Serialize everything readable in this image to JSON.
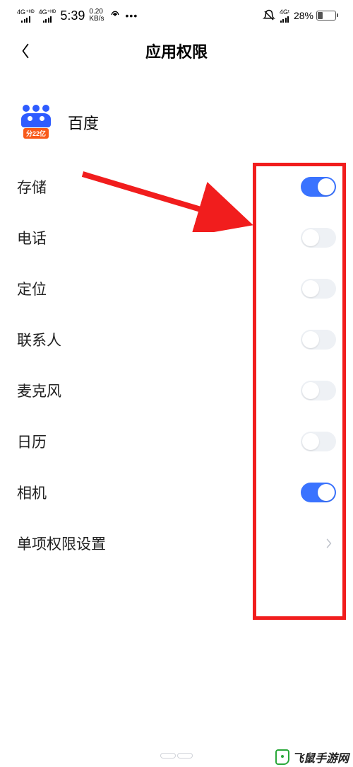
{
  "status_bar": {
    "signal1_label": "4G⁺ᴴᴰ",
    "signal2_label": "4G⁺ᴴᴰ",
    "time": "5:39",
    "data_rate_top": "0.20",
    "data_rate_bottom": "KB/s",
    "hotspot_icon": "wifi-hotspot-icon",
    "more_icon_text": "•••",
    "bell_icon": "bell-off-icon",
    "right_signal_label": "4Gᵗ",
    "battery_percent": "28%"
  },
  "nav": {
    "title": "应用权限"
  },
  "app": {
    "name": "百度",
    "badge": "分22亿"
  },
  "permissions": [
    {
      "label": "存储",
      "enabled": true,
      "type": "toggle"
    },
    {
      "label": "电话",
      "enabled": false,
      "type": "toggle"
    },
    {
      "label": "定位",
      "enabled": false,
      "type": "toggle"
    },
    {
      "label": "联系人",
      "enabled": false,
      "type": "toggle"
    },
    {
      "label": "麦克风",
      "enabled": false,
      "type": "toggle"
    },
    {
      "label": "日历",
      "enabled": false,
      "type": "toggle"
    },
    {
      "label": "相机",
      "enabled": true,
      "type": "toggle"
    },
    {
      "label": "单项权限设置",
      "type": "link"
    }
  ],
  "watermark": {
    "text": "飞鼠手游网"
  }
}
